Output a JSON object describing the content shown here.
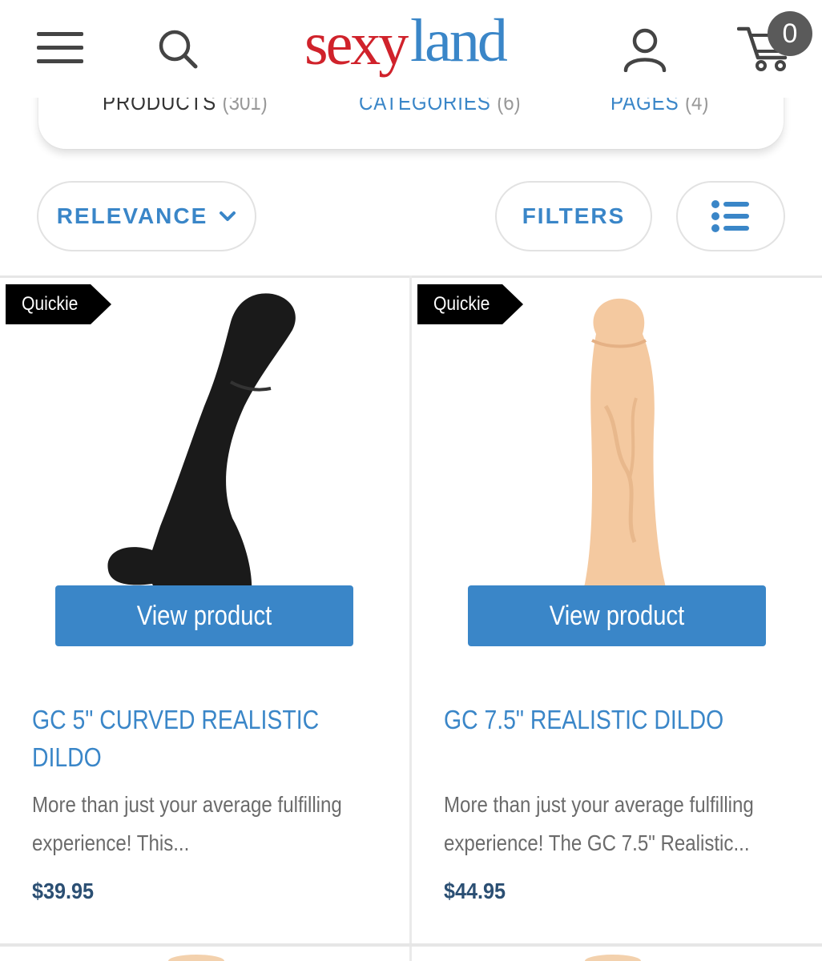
{
  "header": {
    "logo": {
      "part1": "sexy",
      "part2": "land",
      "color_primary": "#d0222b",
      "color_secondary": "#3a86c8"
    },
    "cart_count": "0",
    "icons": [
      "menu-icon",
      "search-icon",
      "user-icon",
      "cart-icon"
    ]
  },
  "tabs": [
    {
      "label": "PRODUCTS",
      "count": "(301)"
    },
    {
      "label": "CATEGORIES",
      "count": "(6)"
    },
    {
      "label": "PAGES",
      "count": "(4)"
    }
  ],
  "controls": {
    "sort_label": "RELEVANCE",
    "filters_label": "FILTERS",
    "view_icon": "list-view-icon"
  },
  "products": [
    {
      "badge": "Quickie",
      "button": "View product",
      "title": "GC 5\" CURVED REALISTIC DILDO",
      "description": "More than just your average fulfilling experience! This...",
      "price": "$39.95",
      "image_color": "#1a1a1a"
    },
    {
      "badge": "Quickie",
      "button": "View product",
      "title": "GC 7.5\" REALISTIC DILDO",
      "description": "More than just your average fulfilling experience! The GC 7.5\" Realistic...",
      "price": "$44.95",
      "image_color": "#f4c9a0"
    }
  ],
  "colors": {
    "accent": "#3a86c8",
    "price": "#2b4f73",
    "badge_bg": "#000000"
  }
}
